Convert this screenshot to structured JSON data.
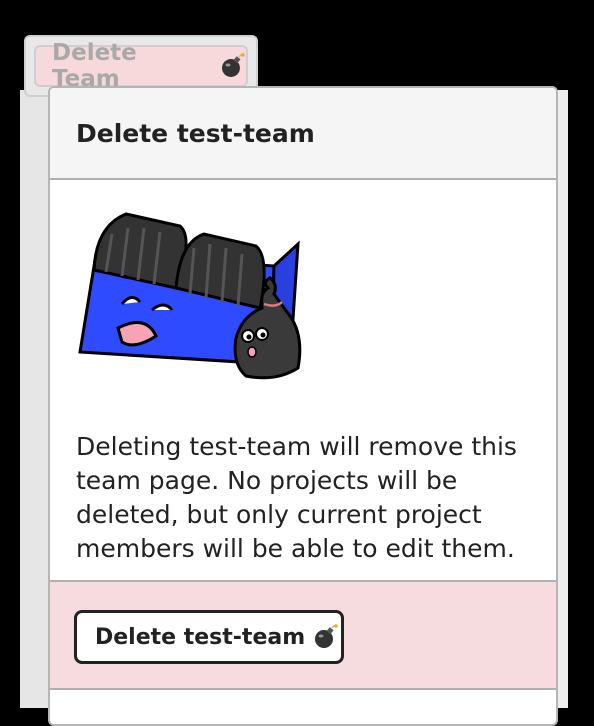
{
  "trigger": {
    "label": "Delete Team",
    "icon": "bomb-icon"
  },
  "popover": {
    "title": "Delete test-team",
    "illustration": "dumpster-with-trash-bag",
    "description": "Deleting test-team will remove this team page. No projects will be deleted, but only current project members will be able to edit them.",
    "confirm_label": "Delete test-team",
    "confirm_icon": "bomb-icon"
  },
  "colors": {
    "danger_bg": "#f7dcdf",
    "dumpster_blue": "#2f4bff",
    "text": "#222222"
  }
}
